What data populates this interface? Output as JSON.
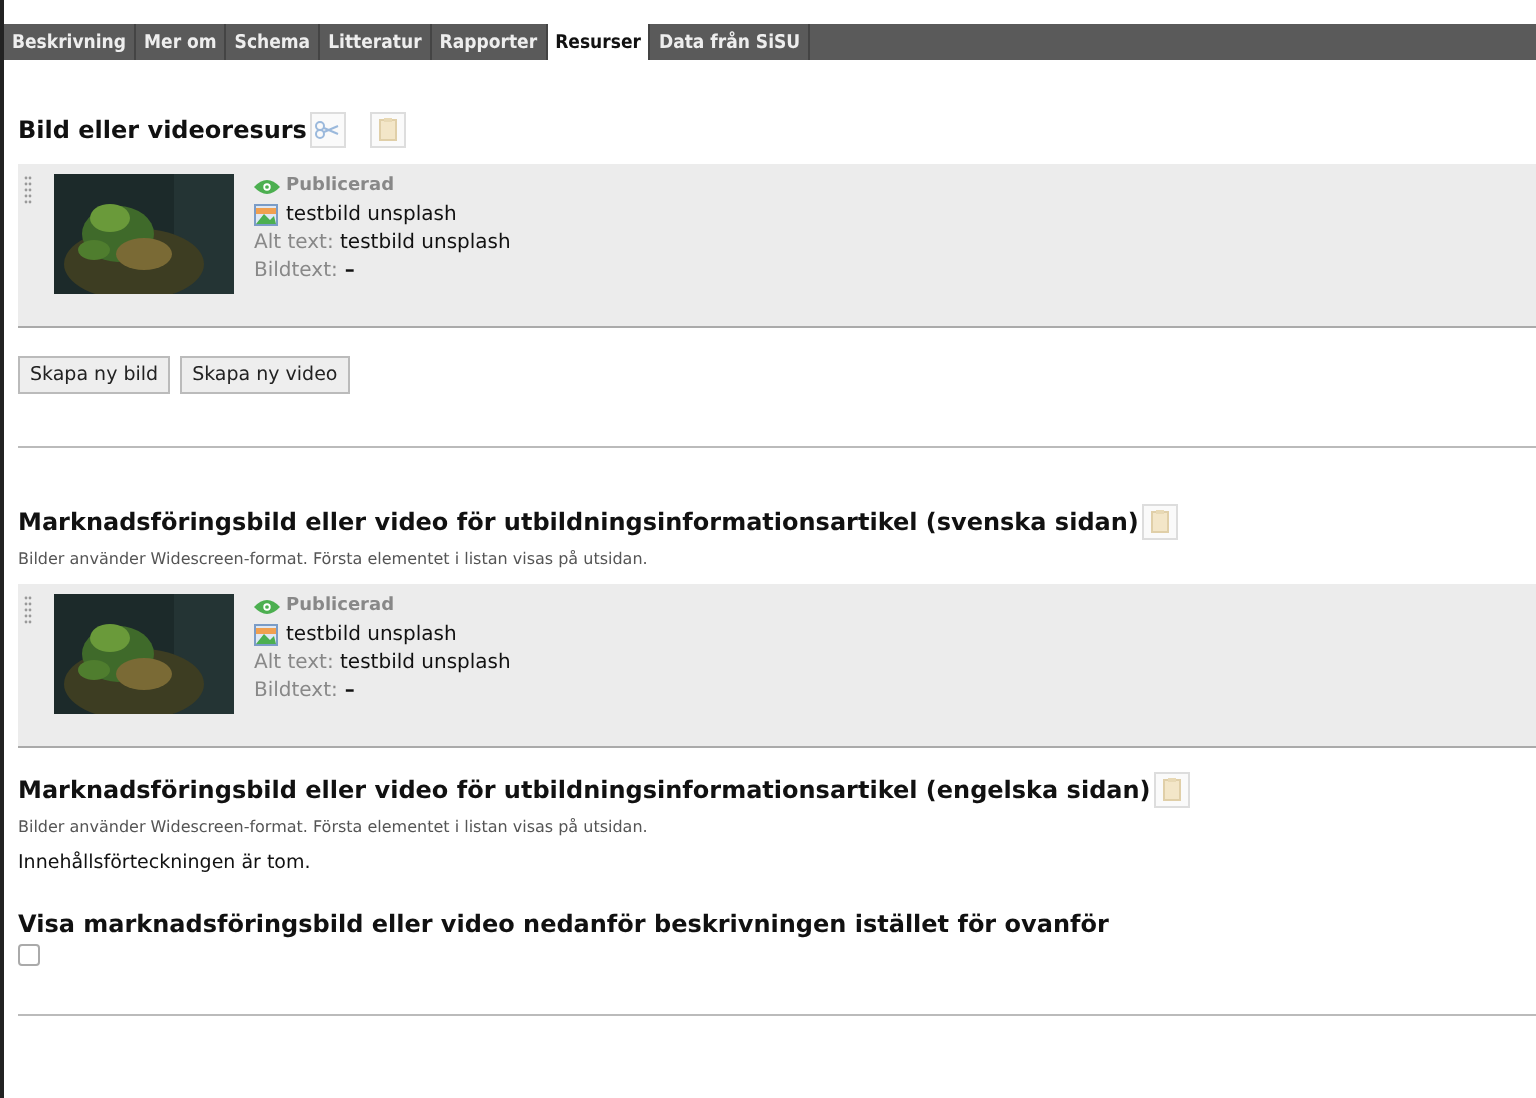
{
  "tabs": [
    {
      "label": "Beskrivning",
      "selected": false
    },
    {
      "label": "Mer om",
      "selected": false
    },
    {
      "label": "Schema",
      "selected": false
    },
    {
      "label": "Litteratur",
      "selected": false
    },
    {
      "label": "Rapporter",
      "selected": false
    },
    {
      "label": "Resurser",
      "selected": true
    },
    {
      "label": "Data från SiSU",
      "selected": false
    }
  ],
  "media_section": {
    "title": "Bild eller videoresurs",
    "items": [
      {
        "status": "Publicerad",
        "published": true,
        "file": "testbild unsplash",
        "alt_label": "Alt text:",
        "alt": "testbild unsplash",
        "caption_label": "Bildtext:",
        "caption": "–"
      }
    ],
    "buttons": [
      "Skapa ny bild",
      "Skapa ny video"
    ]
  },
  "marketing_sections": [
    {
      "title": "Marknadsföringsbild eller video för utbildningsinformationsartikel (svenska sidan)",
      "hint": "Bilder använder Widescreen-format. Första elementet i listan visas på utsidan.",
      "items": [
        {
          "status": "Publicerad",
          "published": true,
          "file": "testbild unsplash",
          "alt_label": "Alt text:",
          "alt": "testbild unsplash",
          "caption_label": "Bildtext:",
          "caption": "–"
        }
      ]
    },
    {
      "title": "Marknadsföringsbild eller video för utbildningsinformationsartikel (engelska sidan)",
      "hint": "Bilder använder Widescreen-format. Första elementet i listan visas på utsidan.",
      "empty_text": "Innehållsförteckningen är tom."
    }
  ],
  "placement": {
    "title": "Visa marknadsföringsbild eller video nedanför beskrivningen istället för ovanför",
    "checked": false
  }
}
